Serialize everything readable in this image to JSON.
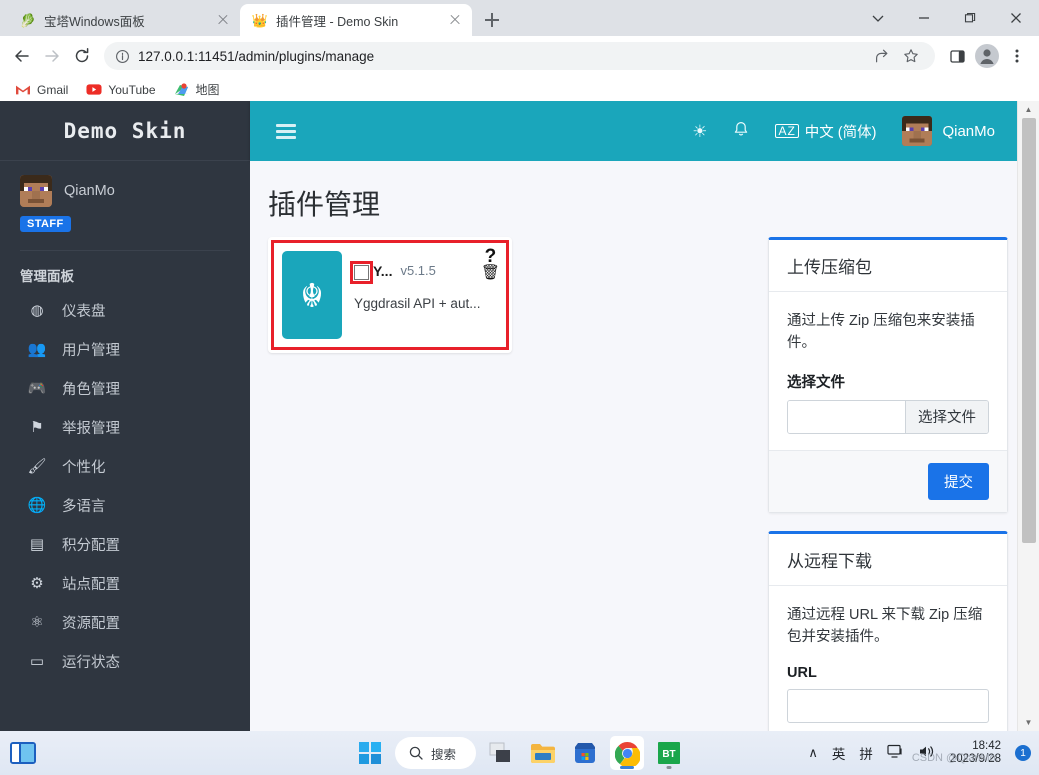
{
  "browser": {
    "tabs": [
      {
        "title": "宝塔Windows面板",
        "favicon": "🥬",
        "active": false
      },
      {
        "title": "插件管理 - Demo Skin",
        "favicon": "👑",
        "active": true
      }
    ],
    "new_tab_label": "+",
    "window_controls": [
      "tab-search",
      "minimize",
      "maximize",
      "close"
    ],
    "nav": {
      "back": "←",
      "forward": "→",
      "reload": "⟳",
      "info_icon": "ⓘ"
    },
    "url": "127.0.0.1:11451/admin/plugins/manage",
    "omnibox_actions": [
      "share-icon",
      "bookmark-star-icon",
      "sidepanel-icon",
      "profile-icon",
      "menu-icon"
    ],
    "bookmarks": [
      {
        "label": "Gmail",
        "icon": "M"
      },
      {
        "label": "YouTube",
        "icon": "▶"
      },
      {
        "label": "地图",
        "icon": "📍"
      }
    ]
  },
  "sidebar": {
    "brand": "Demo Skin",
    "user": {
      "name": "QianMo",
      "badge": "STAFF"
    },
    "section_label": "管理面板",
    "items": [
      {
        "label": "仪表盘",
        "icon": "◍"
      },
      {
        "label": "用户管理",
        "icon": "👥"
      },
      {
        "label": "角色管理",
        "icon": "🎮"
      },
      {
        "label": "举报管理",
        "icon": "⚑"
      },
      {
        "label": "个性化",
        "icon": "🖌"
      },
      {
        "label": "多语言",
        "icon": "🌐"
      },
      {
        "label": "积分配置",
        "icon": "▤"
      },
      {
        "label": "站点配置",
        "icon": "⚙"
      },
      {
        "label": "资源配置",
        "icon": "⚛"
      },
      {
        "label": "运行状态",
        "icon": "▭"
      }
    ]
  },
  "topbar": {
    "menu_toggle": "☰",
    "gear": "☀",
    "bell": "🔔",
    "language": {
      "icon": "AZ",
      "label": "中文 (简体)"
    },
    "user": "QianMo"
  },
  "main": {
    "page_title": "插件管理",
    "plugin": {
      "icon_glyph": "☬",
      "name": "Y...",
      "version": "v5.1.5",
      "description": "Yggdrasil API + aut...",
      "checkbox_checked": false,
      "help_icon": "?",
      "delete_icon": "🗑",
      "highlight_color": "#e8202a"
    },
    "panels": [
      {
        "title": "上传压缩包",
        "text": "通过上传 Zip 压缩包来安装插件。",
        "field_label": "选择文件",
        "file_input_value": "",
        "file_button": "选择文件",
        "submit": "提交"
      },
      {
        "title": "从远程下载",
        "text": "通过远程 URL 来下载 Zip 压缩包并安装插件。",
        "field_label": "URL",
        "url_value": ""
      }
    ]
  },
  "scrollbar": {
    "up_arrow": "▲",
    "down_arrow": "▼"
  },
  "taskbar": {
    "widgets_icon": "widgets-icon",
    "start_icon": "windows-start-icon",
    "search_placeholder": "搜索",
    "apps": [
      {
        "name": "task-view",
        "glyph": "▥",
        "active": false
      },
      {
        "name": "file-explorer",
        "glyph": "📁",
        "active": false
      },
      {
        "name": "microsoft-store",
        "glyph": "🛍",
        "active": false
      },
      {
        "name": "google-chrome",
        "glyph": "◉",
        "active": true
      },
      {
        "name": "bt-panel",
        "glyph": "BT",
        "active": false
      }
    ],
    "tray": {
      "chevron": "∧",
      "ime_lang": "英",
      "ime_mode": "拼",
      "network": "🖥",
      "volume": "🔊"
    },
    "clock": {
      "time": "18:42",
      "date": "2023/9/28"
    },
    "notification_count": "1",
    "watermark": "CSDN @QianMo."
  },
  "colors": {
    "teal": "#1aa6bb",
    "sidebar": "#2f3640",
    "accent_blue": "#1a73e8",
    "highlight_red": "#e8202a"
  }
}
